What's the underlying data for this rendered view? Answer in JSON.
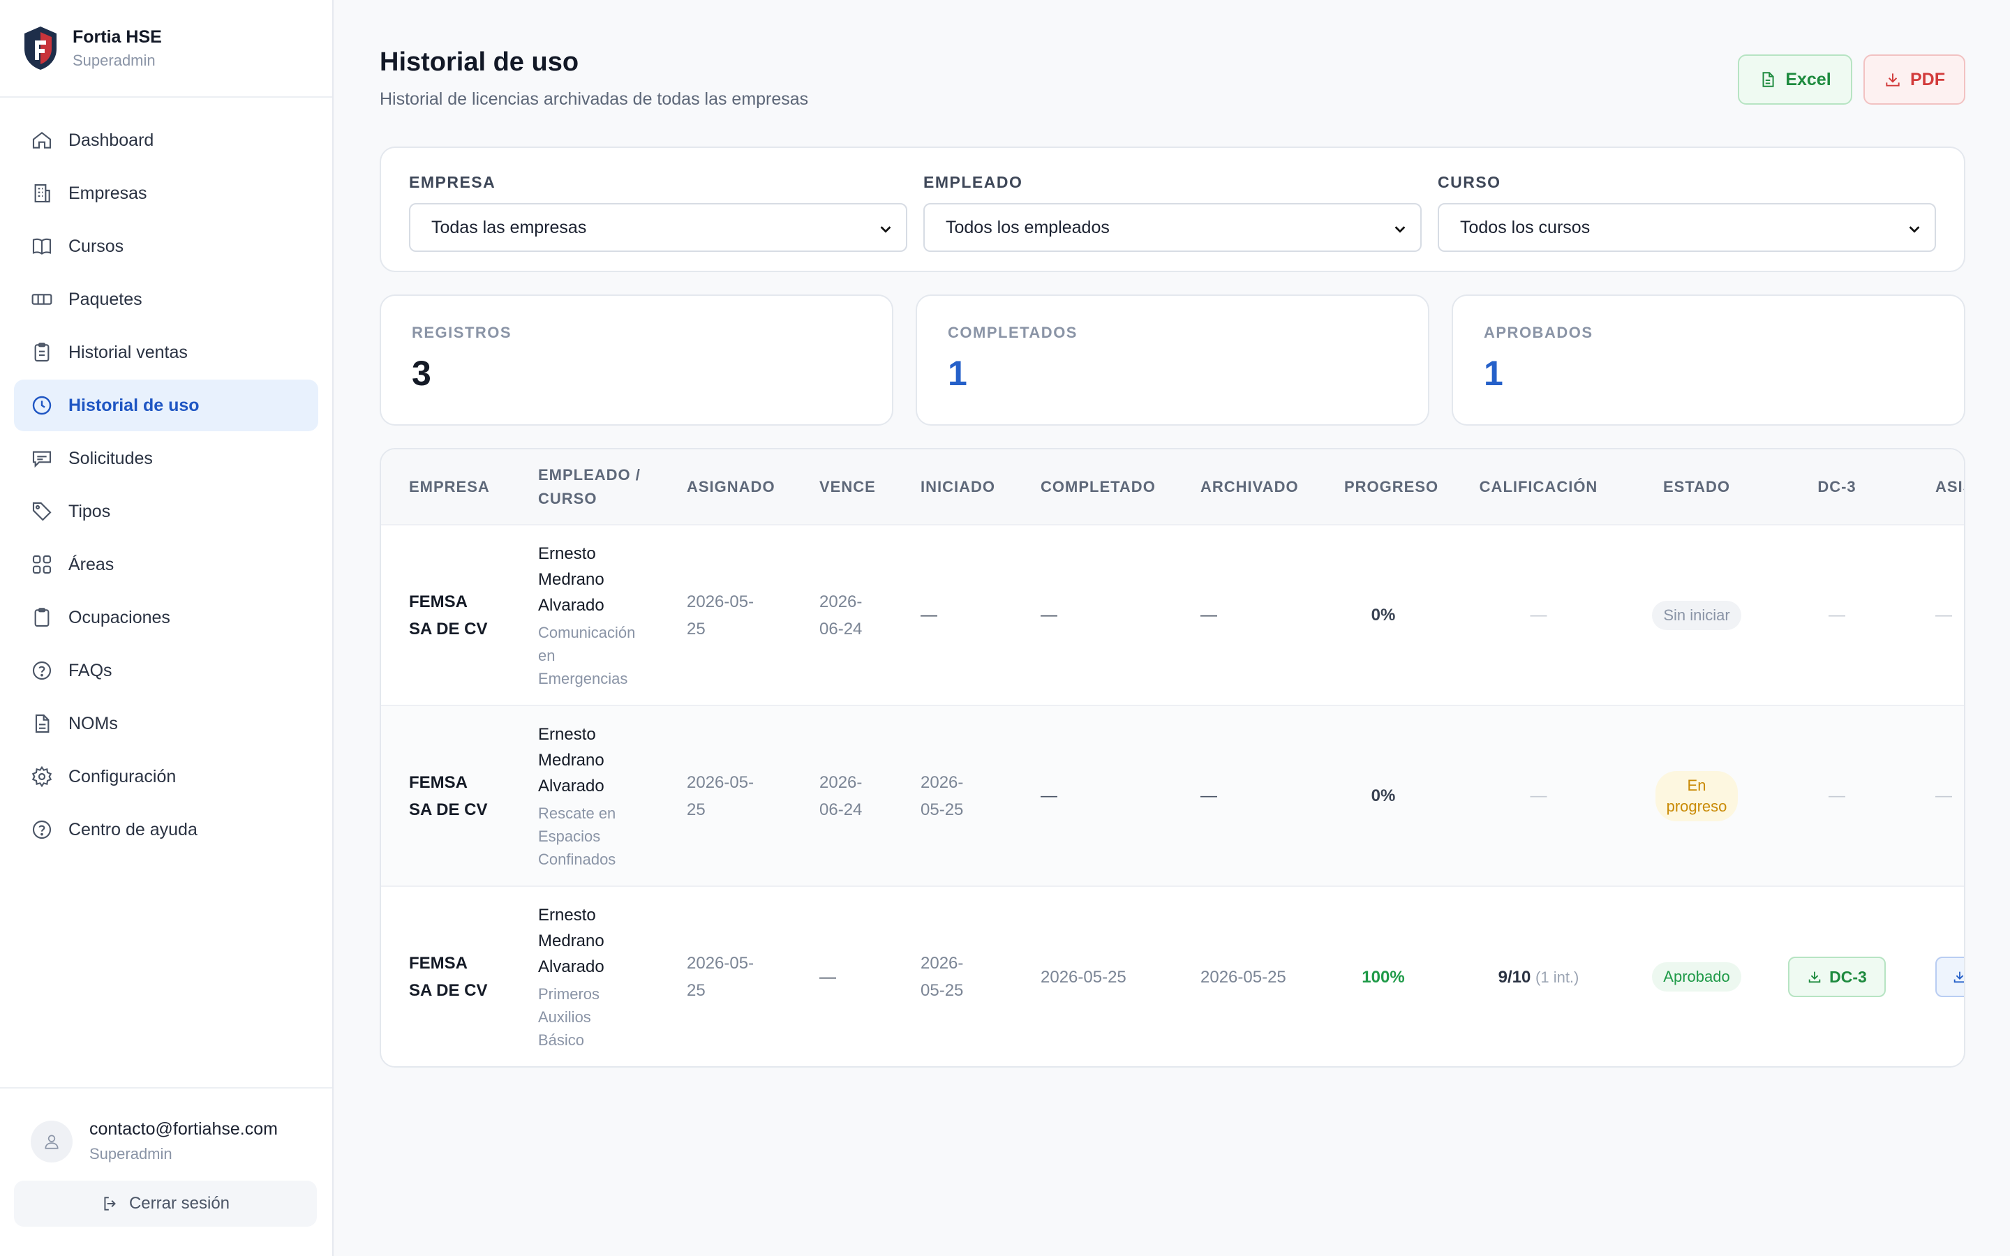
{
  "brand": {
    "name": "Fortia HSE",
    "role": "Superadmin"
  },
  "sidebar": {
    "items": [
      {
        "label": "Dashboard",
        "icon": "home-icon"
      },
      {
        "label": "Empresas",
        "icon": "building-icon"
      },
      {
        "label": "Cursos",
        "icon": "book-icon"
      },
      {
        "label": "Paquetes",
        "icon": "ticket-icon"
      },
      {
        "label": "Historial ventas",
        "icon": "clipboard-icon"
      },
      {
        "label": "Historial de uso",
        "icon": "clock-icon",
        "active": true
      },
      {
        "label": "Solicitudes",
        "icon": "message-icon"
      },
      {
        "label": "Tipos",
        "icon": "tag-icon"
      },
      {
        "label": "Áreas",
        "icon": "grid-icon"
      },
      {
        "label": "Ocupaciones",
        "icon": "clipboard-list-icon"
      },
      {
        "label": "FAQs",
        "icon": "help-circle-icon"
      },
      {
        "label": "NOMs",
        "icon": "document-icon"
      },
      {
        "label": "Configuración",
        "icon": "gear-icon"
      },
      {
        "label": "Centro de ayuda",
        "icon": "help-icon"
      }
    ]
  },
  "user": {
    "email": "contacto@fortiahse.com",
    "role": "Superadmin",
    "logout": "Cerrar sesión"
  },
  "header": {
    "title": "Historial de uso",
    "subtitle": "Historial de licencias archivadas de todas las empresas",
    "excel_label": "Excel",
    "pdf_label": "PDF"
  },
  "filters": {
    "empresa": {
      "label": "EMPRESA",
      "value": "Todas las empresas"
    },
    "empleado": {
      "label": "EMPLEADO",
      "value": "Todos los empleados"
    },
    "curso": {
      "label": "CURSO",
      "value": "Todos los cursos"
    }
  },
  "stats": {
    "registros": {
      "label": "REGISTROS",
      "value": "3"
    },
    "completados": {
      "label": "COMPLETADOS",
      "value": "1"
    },
    "aprobados": {
      "label": "APROBADOS",
      "value": "1"
    }
  },
  "table": {
    "headers": {
      "empresa": "EMPRESA",
      "empleado_1": "EMPLEADO /",
      "empleado_2": "CURSO",
      "asignado": "ASIGNADO",
      "vence": "VENCE",
      "iniciado": "INICIADO",
      "completado": "COMPLETADO",
      "archivado": "ARCHIVADO",
      "progreso": "PROGRESO",
      "calificacion": "CALIFICACIÓN",
      "estado": "ESTADO",
      "dc3": "DC-3",
      "asist": "ASIST"
    },
    "rows": [
      {
        "empresa_1": "FEMSA",
        "empresa_2": "SA DE CV",
        "emp_1": "Ernesto",
        "emp_2": "Medrano",
        "emp_3": "Alvarado",
        "curso_1": "Comunicación",
        "curso_2": "en",
        "curso_3": "Emergencias",
        "asignado_1": "2026-05-",
        "asignado_2": "25",
        "vence_1": "2026-",
        "vence_2": "06-24",
        "iniciado_1": "—",
        "iniciado_2": "",
        "completado": "—",
        "archivado": "—",
        "progreso": "0%",
        "calificacion": "—",
        "estado": "Sin iniciar",
        "dc3": "—",
        "asist": "—"
      },
      {
        "empresa_1": "FEMSA",
        "empresa_2": "SA DE CV",
        "emp_1": "Ernesto",
        "emp_2": "Medrano",
        "emp_3": "Alvarado",
        "curso_1": "Rescate en",
        "curso_2": "Espacios",
        "curso_3": "Confinados",
        "asignado_1": "2026-05-",
        "asignado_2": "25",
        "vence_1": "2026-",
        "vence_2": "06-24",
        "iniciado_1": "2026-",
        "iniciado_2": "05-25",
        "completado": "—",
        "archivado": "—",
        "progreso": "0%",
        "calificacion": "—",
        "estado_1": "En",
        "estado_2": "progreso",
        "dc3": "—",
        "asist": "—"
      },
      {
        "empresa_1": "FEMSA",
        "empresa_2": "SA DE CV",
        "emp_1": "Ernesto",
        "emp_2": "Medrano",
        "emp_3": "Alvarado",
        "curso_1": "Primeros",
        "curso_2": "Auxilios",
        "curso_3": "Básico",
        "asignado_1": "2026-05-",
        "asignado_2": "25",
        "vence": "—",
        "iniciado_1": "2026-",
        "iniciado_2": "05-25",
        "completado": "2026-05-25",
        "archivado": "2026-05-25",
        "progreso": "100%",
        "calificacion": "9/10",
        "calificacion_note": "(1 int.)",
        "estado": "Aprobado",
        "dc3": "DC-3"
      }
    ]
  },
  "colors": {
    "accent": "#1f56c3",
    "success": "#1f9a48",
    "danger": "#d23b3b",
    "warning": "#c98a06"
  }
}
